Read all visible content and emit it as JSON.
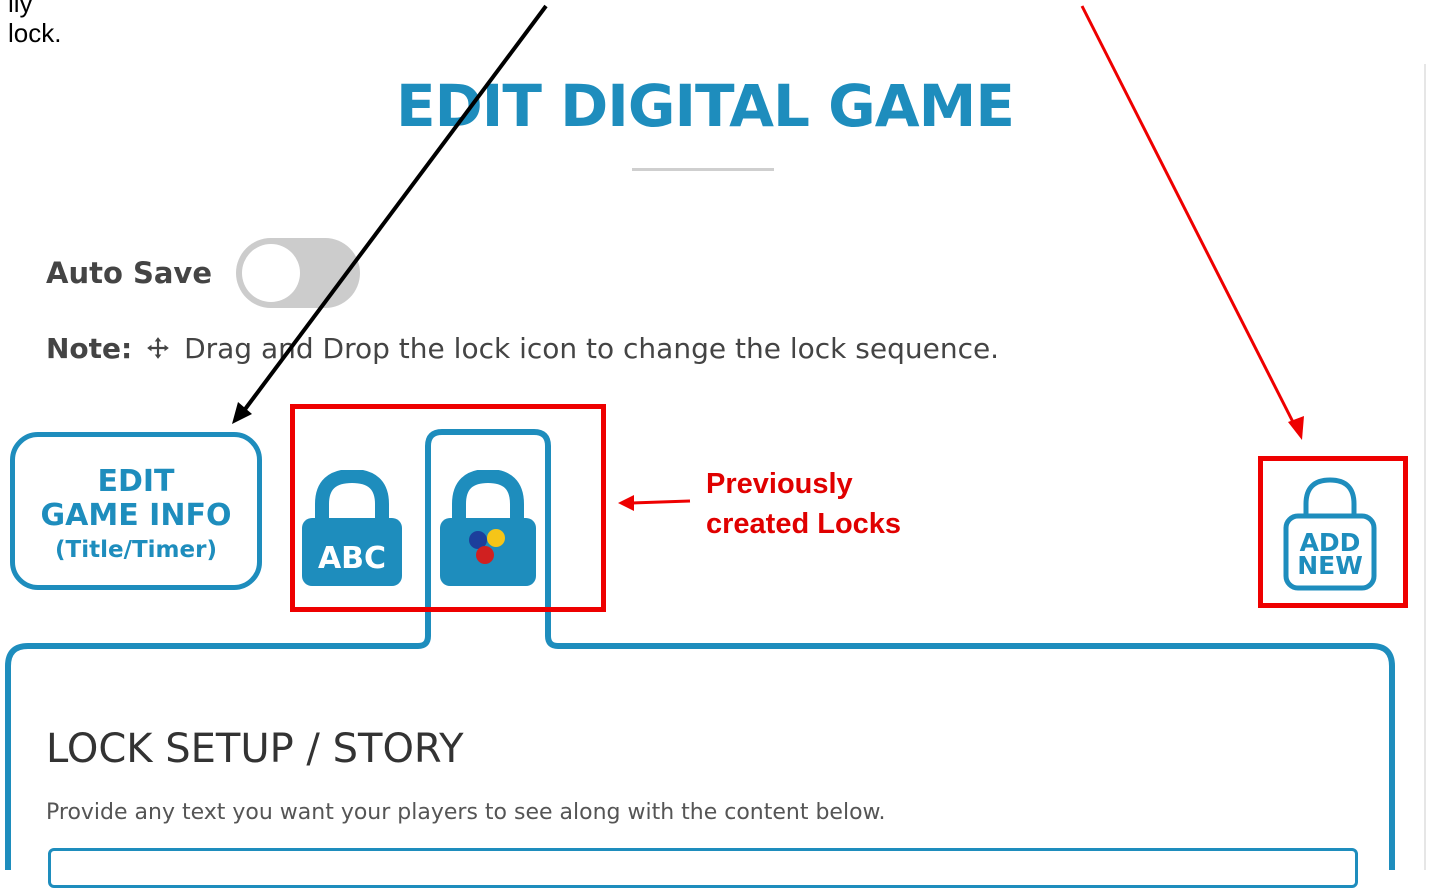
{
  "top_note": {
    "line1": "lly",
    "line2": "lock."
  },
  "page_title": "EDIT DIGITAL GAME",
  "auto_save": {
    "label": "Auto Save",
    "enabled": false
  },
  "note": {
    "strong": "Note:",
    "text": "Drag and Drop the lock icon to change the lock sequence."
  },
  "edit_game_info": {
    "line1": "EDIT",
    "line2": "GAME INFO",
    "line3": "(Title/Timer)"
  },
  "locks": [
    {
      "label": "ABC",
      "icon": "text-lock-icon"
    },
    {
      "label": "",
      "icon": "color-lock-icon",
      "selected": true
    }
  ],
  "add_new": {
    "line1": "ADD",
    "line2": "NEW"
  },
  "annotation": {
    "line1": "Previously",
    "line2": "created Locks"
  },
  "section": {
    "title": "LOCK SETUP / STORY",
    "subtitle": "Provide any text you want your players to see along with the content below."
  },
  "colors": {
    "accent": "#1e8dbd",
    "annotation_red": "#ee0000",
    "dot_blue": "#1c3f9c",
    "dot_yellow": "#f5c518",
    "dot_red": "#d02020"
  }
}
